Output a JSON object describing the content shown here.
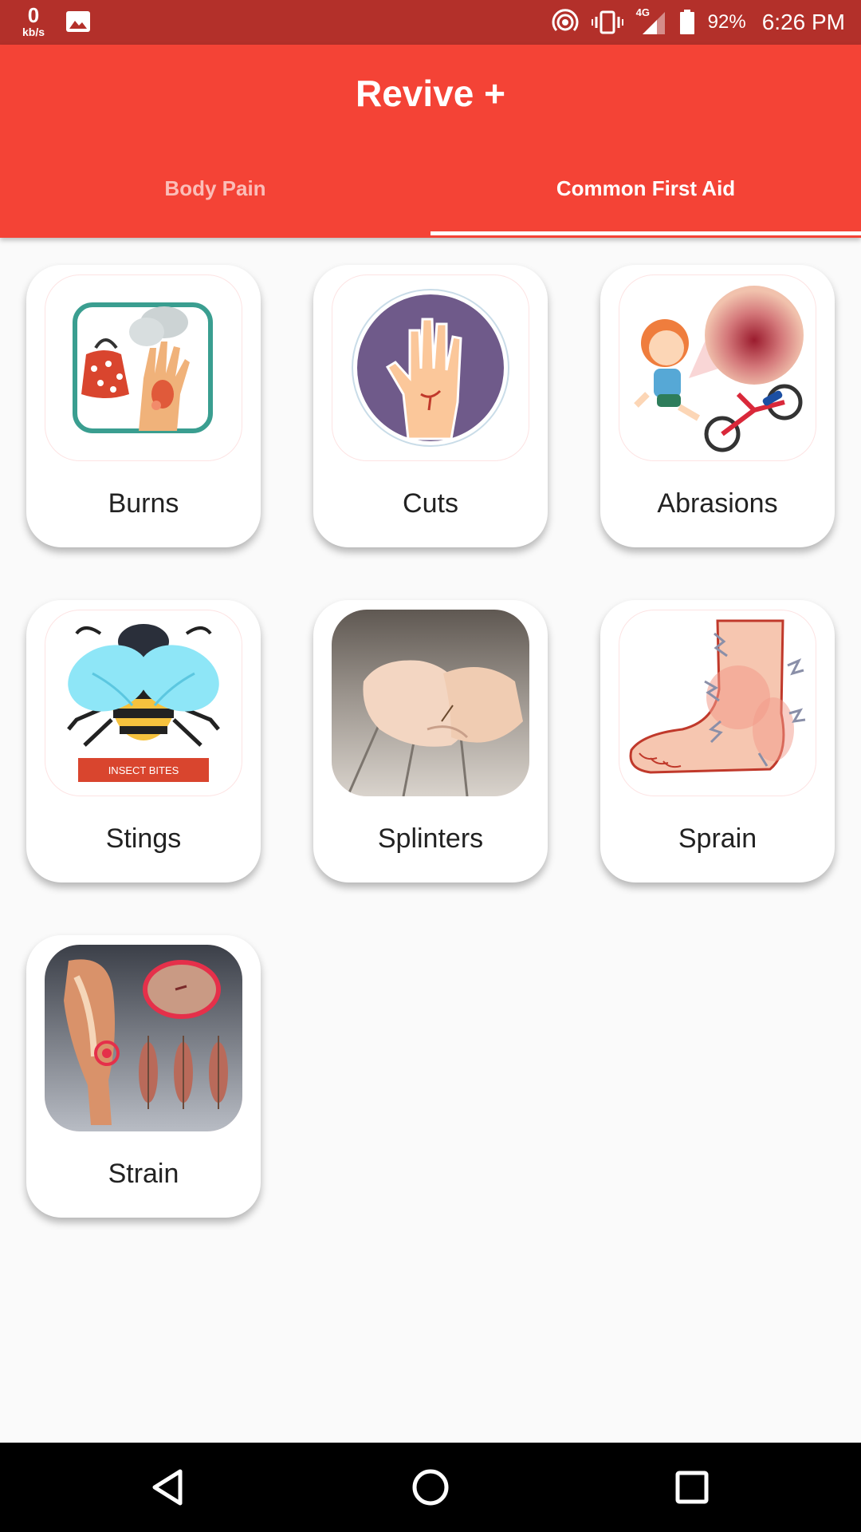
{
  "status_bar": {
    "net_speed_value": "0",
    "net_speed_unit": "kb/s",
    "network_type": "4G",
    "battery": "92%",
    "time": "6:26 PM"
  },
  "app": {
    "title": "Revive +",
    "tabs": [
      {
        "label": "Body Pain",
        "selected": false
      },
      {
        "label": "Common First Aid",
        "selected": true
      }
    ],
    "accent_color": "#f44336",
    "status_bar_color": "#b3302a"
  },
  "cards": [
    {
      "label": "Burns",
      "icon": "burns-image"
    },
    {
      "label": "Cuts",
      "icon": "cuts-image"
    },
    {
      "label": "Abrasions",
      "icon": "abrasions-image"
    },
    {
      "label": "Stings",
      "icon": "stings-image",
      "image_caption": "INSECT BITES"
    },
    {
      "label": "Splinters",
      "icon": "splinters-image"
    },
    {
      "label": "Sprain",
      "icon": "sprain-image"
    },
    {
      "label": "Strain",
      "icon": "strain-image"
    }
  ]
}
